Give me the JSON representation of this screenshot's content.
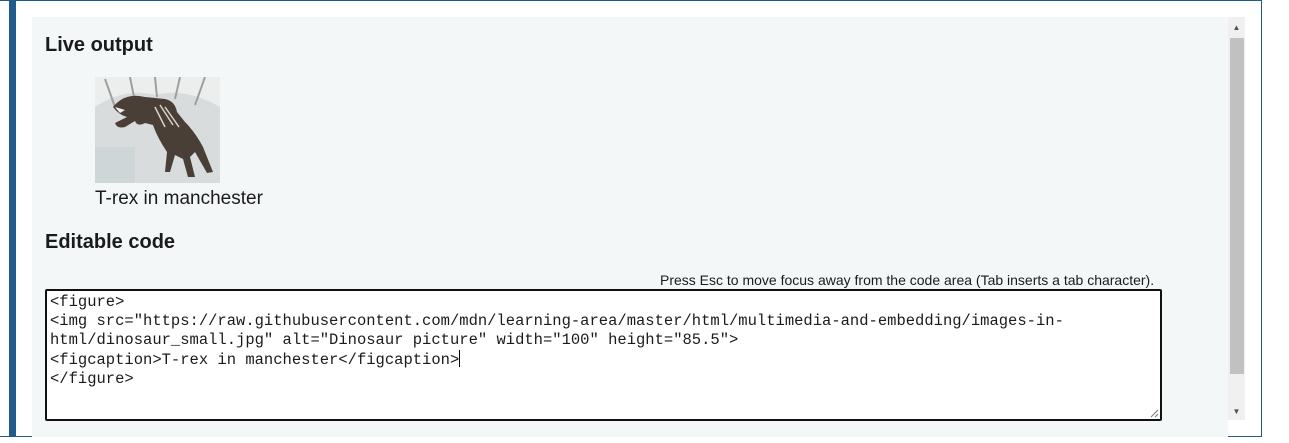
{
  "live_output": {
    "heading": "Live output",
    "figure": {
      "image_alt": "Dinosaur picture",
      "caption": "T-rex in manchester"
    }
  },
  "editable_code": {
    "heading": "Editable code",
    "hint": "Press Esc to move focus away from the code area (Tab inserts a tab character).",
    "lines": [
      "<figure>",
      "<img src=\"https://raw.githubusercontent.com/mdn/learning-area/master/html/multimedia-and-embedding/images-in-",
      "html/dinosaur_small.jpg\" alt=\"Dinosaur picture\" width=\"100\" height=\"85.5\">",
      "<figcaption>T-rex in manchester</figcaption>",
      "</figure>"
    ]
  },
  "colors": {
    "accent_bar": "#1f5c8a",
    "panel_bg": "#f4f7f8"
  }
}
